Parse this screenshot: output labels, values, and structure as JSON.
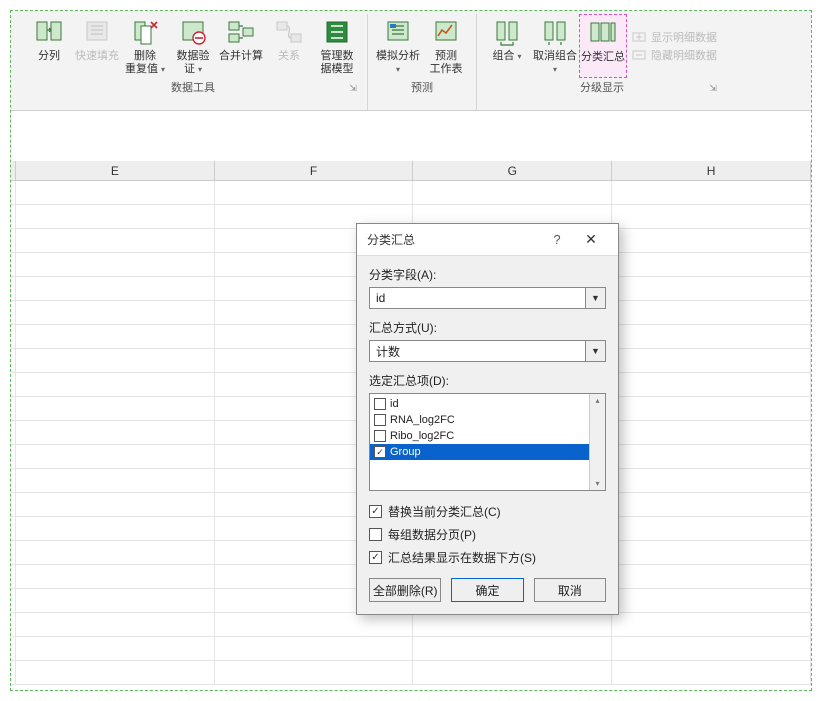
{
  "ribbon": {
    "groups": [
      {
        "label": "数据工具",
        "items": [
          {
            "label": "分列",
            "icon": "text-to-columns",
            "disabled": false
          },
          {
            "label": "快速填充",
            "icon": "flash-fill",
            "disabled": true
          },
          {
            "label": "删除\n重复值",
            "icon": "remove-duplicates",
            "disabled": false,
            "dropdown": true
          },
          {
            "label": "数据验\n证",
            "icon": "data-validation",
            "disabled": false,
            "dropdown": true
          },
          {
            "label": "合并计算",
            "icon": "consolidate",
            "disabled": false
          },
          {
            "label": "关系",
            "icon": "relationships",
            "disabled": true
          },
          {
            "label": "管理数\n据模型",
            "icon": "data-model",
            "disabled": false
          }
        ],
        "launcher": true
      },
      {
        "label": "预测",
        "items": [
          {
            "label": "模拟分析",
            "icon": "what-if",
            "disabled": false,
            "dropdown": true
          },
          {
            "label": "预测\n工作表",
            "icon": "forecast-sheet",
            "disabled": false
          }
        ]
      },
      {
        "label": "分级显示",
        "items": [
          {
            "label": "组合",
            "icon": "group",
            "disabled": false,
            "dropdown": true
          },
          {
            "label": "取消组合",
            "icon": "ungroup",
            "disabled": false,
            "dropdown": true
          },
          {
            "label": "分类汇总",
            "icon": "subtotal",
            "disabled": false,
            "highlight": true
          }
        ],
        "side": [
          {
            "label": "显示明细数据",
            "icon": "show-detail"
          },
          {
            "label": "隐藏明细数据",
            "icon": "hide-detail"
          }
        ],
        "launcher": true
      }
    ]
  },
  "columns": [
    "E",
    "F",
    "G",
    "H"
  ],
  "dialog": {
    "title": "分类汇总",
    "field_label": "分类字段(A):",
    "field_value": "id",
    "func_label": "汇总方式(U):",
    "func_value": "计数",
    "list_label": "选定汇总项(D):",
    "list_items": [
      {
        "label": "id",
        "checked": false,
        "selected": false
      },
      {
        "label": "RNA_log2FC",
        "checked": false,
        "selected": false
      },
      {
        "label": "Ribo_log2FC",
        "checked": false,
        "selected": false
      },
      {
        "label": "Group",
        "checked": true,
        "selected": true
      }
    ],
    "opt_replace": {
      "label": "替换当前分类汇总(C)",
      "checked": true
    },
    "opt_pagebreak": {
      "label": "每组数据分页(P)",
      "checked": false
    },
    "opt_below": {
      "label": "汇总结果显示在数据下方(S)",
      "checked": true
    },
    "btn_removeall": "全部删除(R)",
    "btn_ok": "确定",
    "btn_cancel": "取消"
  }
}
